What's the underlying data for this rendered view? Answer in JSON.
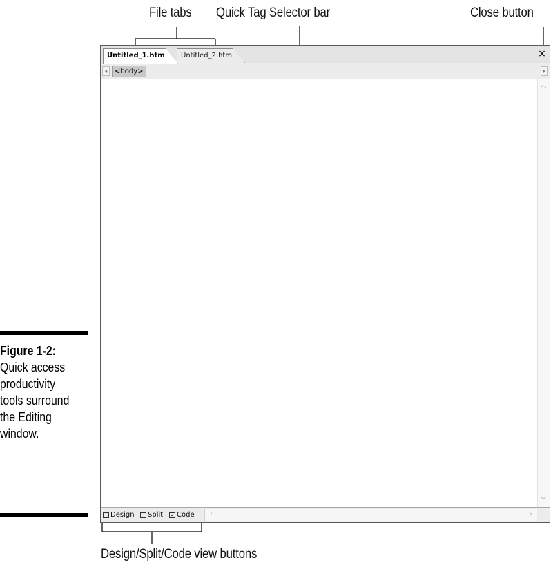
{
  "callouts": {
    "file_tabs": "File tabs",
    "quick_tag_selector": "Quick Tag Selector bar",
    "close_button": "Close button",
    "view_buttons": "Design/Split/Code view buttons"
  },
  "caption": {
    "figure": "Figure 1-2:",
    "text": "Quick access productivity tools surround the Editing window."
  },
  "editor": {
    "tabs": [
      {
        "label": "Untitled_1.htm",
        "active": true
      },
      {
        "label": "Untitled_2.htm",
        "active": false
      }
    ],
    "close_glyph": "×",
    "tag_selector": {
      "tag": "<body>"
    },
    "view_buttons": [
      {
        "label": "Design"
      },
      {
        "label": "Split"
      },
      {
        "label": "Code"
      }
    ]
  }
}
